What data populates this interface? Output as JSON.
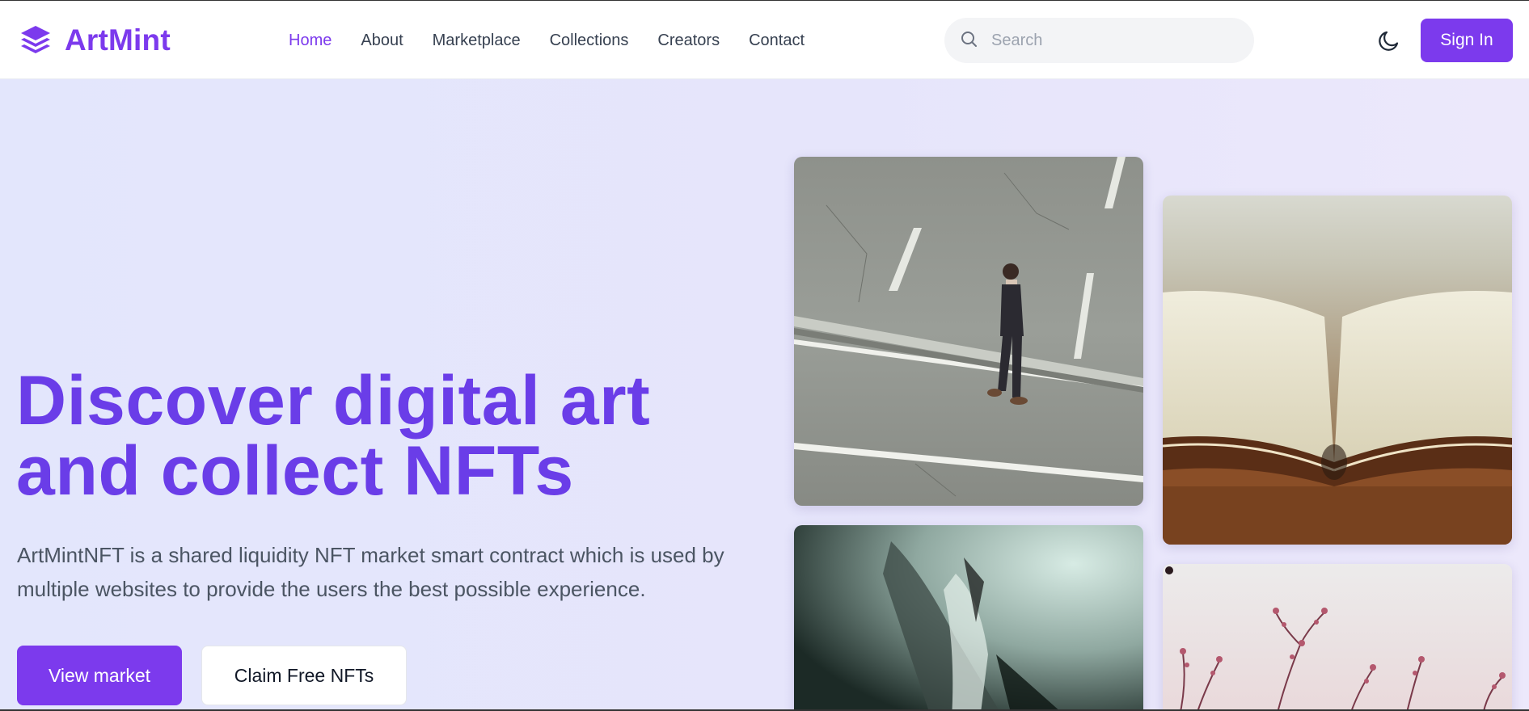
{
  "header": {
    "logo_text": "ArtMint",
    "logo_icon": "layers-icon",
    "nav": [
      {
        "label": "Home",
        "active": true
      },
      {
        "label": "About",
        "active": false
      },
      {
        "label": "Marketplace",
        "active": false
      },
      {
        "label": "Collections",
        "active": false
      },
      {
        "label": "Creators",
        "active": false
      },
      {
        "label": "Contact",
        "active": false
      }
    ],
    "search": {
      "placeholder": "Search",
      "value": "",
      "icon": "search-icon"
    },
    "theme_icon": "moon-icon",
    "signin_label": "Sign In"
  },
  "hero": {
    "title_line1": "Discover digital art",
    "title_line2": "and collect NFTs",
    "description": "ArtMintNFT is a shared liquidity NFT market smart contract which is used by multiple websites to provide the users the best possible experience.",
    "primary_button": "View market",
    "secondary_button": "Claim Free NFTs"
  },
  "gallery": [
    {
      "name": "man-walking-on-road-image"
    },
    {
      "name": "open-book-image"
    },
    {
      "name": "blurred-abstract-image"
    },
    {
      "name": "blossom-branches-image"
    }
  ],
  "colors": {
    "accent": "#7c3aed",
    "title": "#6a3de8",
    "hero_bg": "#e4e6fc",
    "text": "#374151"
  }
}
